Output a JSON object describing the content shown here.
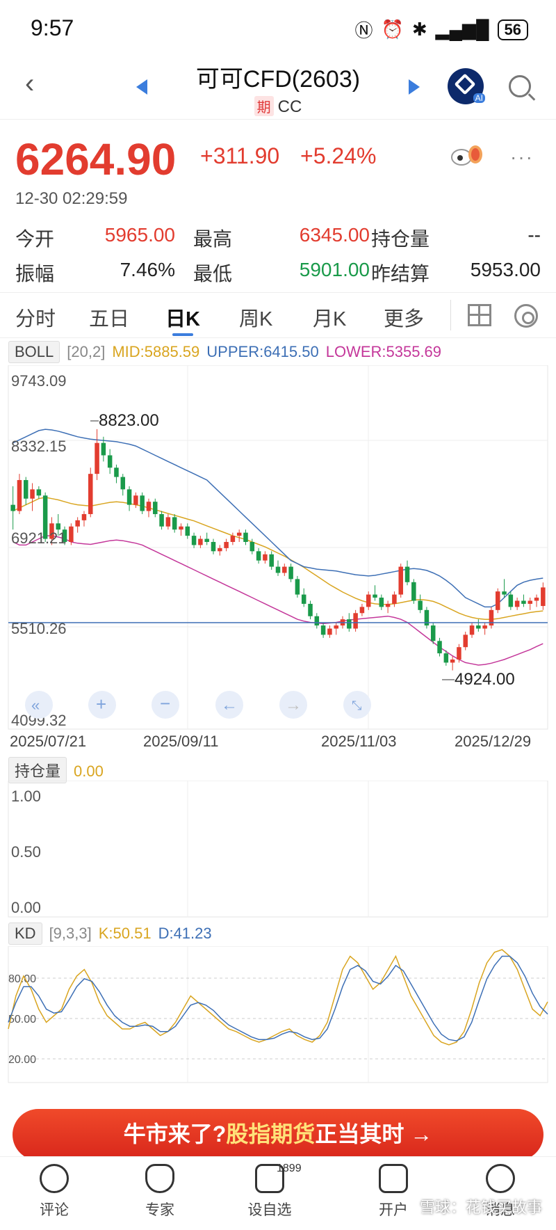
{
  "status_bar": {
    "time": "9:57",
    "battery": "56"
  },
  "header": {
    "title": "可可CFD(2603)",
    "badge": "期",
    "code": "CC"
  },
  "quote": {
    "price": "6264.90",
    "change": "+311.90",
    "change_pct": "+5.24%",
    "timestamp": "12-30 02:29:59"
  },
  "stats": {
    "open_label": "今开",
    "open": "5965.00",
    "high_label": "最高",
    "high": "6345.00",
    "oi_label": "持仓量",
    "oi": "--",
    "amp_label": "振幅",
    "amp": "7.46%",
    "low_label": "最低",
    "low": "5901.00",
    "prev_label": "昨结算",
    "prev": "5953.00"
  },
  "tabs": [
    "分时",
    "五日",
    "日K",
    "周K",
    "月K",
    "更多"
  ],
  "boll": {
    "name": "BOLL",
    "params": "[20,2]",
    "mid": "MID:5885.59",
    "upper": "UPPER:6415.50",
    "lower": "LOWER:5355.69"
  },
  "kline_axis": {
    "y_labels": [
      "9743.09",
      "8332.15",
      "6921.21",
      "5510.26",
      "4099.32"
    ],
    "x_labels": [
      "2025/07/21",
      "2025/09/11",
      "2025/11/03",
      "2025/12/29"
    ],
    "high_mark": "8823.00",
    "low_mark": "4924.00"
  },
  "oi_panel": {
    "name": "持仓量",
    "value": "0.00",
    "y_labels": [
      "1.00",
      "0.50",
      "0.00"
    ]
  },
  "kd_panel": {
    "name": "KD",
    "params": "[9,3,3]",
    "k": "K:50.51",
    "d": "D:41.23",
    "y_labels": [
      "80.00",
      "50.00",
      "20.00"
    ]
  },
  "banner": {
    "part1": "牛市来了?",
    "part2": "股指期货",
    "part3": "正当其时",
    "arrow": "→"
  },
  "bottom_nav": [
    {
      "label": "评论",
      "icon": "comment-icon"
    },
    {
      "label": "专家",
      "icon": "expert-icon"
    },
    {
      "label": "设自选",
      "icon": "watchlist-icon",
      "badge": "1899"
    },
    {
      "label": "开户",
      "icon": "chart-icon"
    },
    {
      "label": "消息",
      "icon": "message-icon"
    }
  ],
  "watermark": "雪球：花钱买故事",
  "colors": {
    "up": "#e23c2f",
    "down": "#1a9a4a",
    "mid": "#d9a520",
    "upper": "#3d6fb5",
    "lower": "#c4379a",
    "brand": "#3b7ddd"
  },
  "chart_data": {
    "type": "candlestick",
    "title": "可可CFD(2603)",
    "x": [
      "2025/07/21",
      "2025/09/11",
      "2025/11/03",
      "2025/12/29"
    ],
    "ylim": [
      4099.32,
      9743.09
    ],
    "candles": [
      [
        7600,
        7900,
        7200,
        7500
      ],
      [
        7500,
        8100,
        7450,
        8000
      ],
      [
        8000,
        8050,
        7600,
        7700
      ],
      [
        7700,
        7950,
        7500,
        7850
      ],
      [
        7850,
        7900,
        7700,
        7750
      ],
      [
        7750,
        7800,
        7000,
        7050
      ],
      [
        7050,
        7400,
        6950,
        7300
      ],
      [
        7300,
        7450,
        7100,
        7200
      ],
      [
        7200,
        7250,
        6950,
        7000
      ],
      [
        7000,
        7300,
        6950,
        7250
      ],
      [
        7250,
        7400,
        7150,
        7350
      ],
      [
        7350,
        7500,
        7250,
        7450
      ],
      [
        7450,
        8200,
        7400,
        8100
      ],
      [
        8100,
        8823,
        8000,
        8600
      ],
      [
        8600,
        8700,
        8300,
        8400
      ],
      [
        8400,
        8500,
        8100,
        8200
      ],
      [
        8200,
        8250,
        7950,
        8050
      ],
      [
        8050,
        8100,
        7750,
        7850
      ],
      [
        7850,
        7900,
        7500,
        7600
      ],
      [
        7600,
        7800,
        7550,
        7750
      ],
      [
        7750,
        7800,
        7450,
        7500
      ],
      [
        7500,
        7700,
        7400,
        7650
      ],
      [
        7650,
        7700,
        7400,
        7450
      ],
      [
        7450,
        7500,
        7200,
        7250
      ],
      [
        7250,
        7450,
        7200,
        7400
      ],
      [
        7400,
        7450,
        7150,
        7200
      ],
      [
        7200,
        7300,
        7100,
        7250
      ],
      [
        7250,
        7300,
        7050,
        7100
      ],
      [
        7100,
        7150,
        6900,
        6950
      ],
      [
        6950,
        7100,
        6900,
        7050
      ],
      [
        7050,
        7150,
        6950,
        7000
      ],
      [
        7000,
        7050,
        6800,
        6850
      ],
      [
        6850,
        6950,
        6780,
        6900
      ],
      [
        6900,
        7050,
        6850,
        7000
      ],
      [
        7000,
        7150,
        6950,
        7100
      ],
      [
        7100,
        7200,
        7000,
        7150
      ],
      [
        7150,
        7200,
        6950,
        7000
      ],
      [
        7000,
        7050,
        6800,
        6850
      ],
      [
        6850,
        6900,
        6650,
        6700
      ],
      [
        6700,
        6850,
        6650,
        6800
      ],
      [
        6800,
        6850,
        6550,
        6600
      ],
      [
        6600,
        6700,
        6450,
        6500
      ],
      [
        6500,
        6650,
        6450,
        6600
      ],
      [
        6600,
        6650,
        6350,
        6400
      ],
      [
        6400,
        6450,
        6100,
        6150
      ],
      [
        6150,
        6250,
        5950,
        6000
      ],
      [
        6000,
        6050,
        5750,
        5800
      ],
      [
        5800,
        5850,
        5600,
        5650
      ],
      [
        5650,
        5700,
        5450,
        5500
      ],
      [
        5500,
        5650,
        5450,
        5600
      ],
      [
        5600,
        5700,
        5500,
        5650
      ],
      [
        5650,
        5800,
        5600,
        5750
      ],
      [
        5750,
        5850,
        5550,
        5600
      ],
      [
        5600,
        5900,
        5550,
        5850
      ],
      [
        5850,
        6000,
        5800,
        5950
      ],
      [
        5950,
        6200,
        5900,
        6150
      ],
      [
        6150,
        6300,
        6050,
        6100
      ],
      [
        6100,
        6150,
        5900,
        5950
      ],
      [
        5950,
        6050,
        5850,
        6000
      ],
      [
        6000,
        6200,
        5950,
        6150
      ],
      [
        6150,
        6650,
        6100,
        6600
      ],
      [
        6600,
        6700,
        6300,
        6350
      ],
      [
        6350,
        6400,
        6000,
        6050
      ],
      [
        6050,
        6150,
        5850,
        5900
      ],
      [
        5900,
        5950,
        5600,
        5650
      ],
      [
        5650,
        5700,
        5350,
        5400
      ],
      [
        5400,
        5450,
        5150,
        5200
      ],
      [
        5200,
        5250,
        5000,
        5050
      ],
      [
        5050,
        5150,
        4924,
        5100
      ],
      [
        5100,
        5350,
        5050,
        5300
      ],
      [
        5300,
        5550,
        5250,
        5500
      ],
      [
        5500,
        5700,
        5450,
        5650
      ],
      [
        5650,
        5750,
        5550,
        5600
      ],
      [
        5600,
        5700,
        5500,
        5650
      ],
      [
        5650,
        5950,
        5600,
        5900
      ],
      [
        5900,
        6250,
        5850,
        6200
      ],
      [
        6200,
        6400,
        6100,
        6150
      ],
      [
        6150,
        6200,
        5900,
        5950
      ],
      [
        5950,
        6100,
        5900,
        6050
      ],
      [
        6050,
        6150,
        5950,
        6000
      ],
      [
        6000,
        6100,
        5900,
        6050
      ],
      [
        6050,
        6150,
        5950,
        6100
      ],
      [
        5965,
        6345,
        5901,
        6264.9
      ]
    ],
    "mid": [
      7500,
      7550,
      7600,
      7650,
      7700,
      7720,
      7700,
      7680,
      7650,
      7620,
      7600,
      7590,
      7580,
      7600,
      7620,
      7640,
      7650,
      7640,
      7620,
      7600,
      7580,
      7550,
      7520,
      7490,
      7460,
      7430,
      7400,
      7370,
      7340,
      7300,
      7260,
      7220,
      7180,
      7140,
      7100,
      7070,
      7040,
      7000,
      6960,
      6920,
      6870,
      6820,
      6770,
      6710,
      6650,
      6590,
      6520,
      6450,
      6380,
      6310,
      6250,
      6190,
      6140,
      6090,
      6050,
      6020,
      6000,
      5990,
      5990,
      6000,
      6020,
      6040,
      6060,
      6070,
      6060,
      6040,
      6000,
      5950,
      5900,
      5850,
      5810,
      5780,
      5760,
      5750,
      5750,
      5760,
      5780,
      5800,
      5820,
      5840,
      5860,
      5875,
      5885.59
    ],
    "upper": [
      8600,
      8650,
      8700,
      8750,
      8800,
      8820,
      8810,
      8790,
      8760,
      8730,
      8700,
      8680,
      8660,
      8650,
      8640,
      8630,
      8620,
      8600,
      8580,
      8550,
      8500,
      8450,
      8400,
      8350,
      8300,
      8250,
      8200,
      8150,
      8100,
      8050,
      8000,
      7900,
      7800,
      7700,
      7600,
      7500,
      7400,
      7300,
      7200,
      7100,
      7000,
      6900,
      6800,
      6700,
      6650,
      6600,
      6580,
      6560,
      6550,
      6540,
      6530,
      6510,
      6490,
      6470,
      6460,
      6450,
      6460,
      6480,
      6500,
      6520,
      6540,
      6560,
      6570,
      6560,
      6540,
      6500,
      6450,
      6380,
      6300,
      6200,
      6100,
      6050,
      6000,
      5950,
      5950,
      6000,
      6100,
      6200,
      6300,
      6350,
      6380,
      6400,
      6415.5
    ],
    "lower": [
      7000,
      6950,
      6950,
      7000,
      7050,
      7100,
      7100,
      7080,
      7050,
      7000,
      6980,
      6970,
      6960,
      6980,
      7000,
      7020,
      7030,
      7020,
      7000,
      6980,
      6950,
      6900,
      6850,
      6800,
      6750,
      6700,
      6650,
      6600,
      6550,
      6500,
      6450,
      6400,
      6350,
      6300,
      6250,
      6200,
      6150,
      6100,
      6050,
      6000,
      5950,
      5900,
      5850,
      5800,
      5750,
      5720,
      5700,
      5690,
      5680,
      5690,
      5700,
      5720,
      5740,
      5750,
      5760,
      5770,
      5780,
      5790,
      5800,
      5780,
      5750,
      5700,
      5620,
      5540,
      5460,
      5380,
      5300,
      5230,
      5160,
      5100,
      5050,
      5030,
      5010,
      5020,
      5040,
      5070,
      5100,
      5140,
      5180,
      5220,
      5260,
      5310,
      5355.69
    ],
    "k": [
      30,
      55,
      70,
      60,
      45,
      35,
      40,
      45,
      60,
      70,
      75,
      65,
      50,
      40,
      35,
      30,
      30,
      33,
      35,
      30,
      25,
      28,
      35,
      45,
      55,
      50,
      45,
      40,
      35,
      30,
      28,
      25,
      22,
      20,
      22,
      25,
      28,
      30,
      25,
      22,
      20,
      25,
      35,
      55,
      75,
      85,
      80,
      70,
      60,
      65,
      75,
      85,
      70,
      55,
      45,
      35,
      25,
      20,
      18,
      20,
      28,
      45,
      65,
      80,
      88,
      90,
      85,
      75,
      60,
      45,
      40,
      50.51
    ],
    "d": [
      35,
      50,
      62,
      62,
      55,
      45,
      42,
      43,
      52,
      62,
      68,
      66,
      58,
      48,
      40,
      35,
      32,
      32,
      33,
      32,
      28,
      28,
      32,
      40,
      48,
      50,
      48,
      44,
      38,
      33,
      30,
      27,
      24,
      22,
      22,
      23,
      26,
      28,
      27,
      24,
      22,
      23,
      30,
      45,
      62,
      75,
      78,
      74,
      66,
      64,
      70,
      78,
      74,
      64,
      54,
      44,
      34,
      26,
      22,
      21,
      24,
      35,
      52,
      68,
      78,
      85,
      85,
      80,
      70,
      57,
      47,
      41.23
    ]
  }
}
